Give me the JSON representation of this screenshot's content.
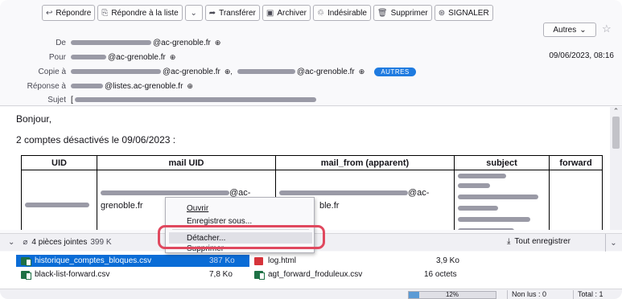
{
  "toolbar": {
    "reply": "Répondre",
    "reply_all": "Répondre à la liste",
    "forward": "Transférer",
    "archive": "Archiver",
    "junk": "Indésirable",
    "delete": "Supprimer",
    "report": "SIGNALER",
    "more": "Autres"
  },
  "header": {
    "from_label": "De",
    "from_value": "@ac-grenoble.fr",
    "to_label": "Pour",
    "to_value": "@ac-grenoble.fr",
    "cc_label": "Copie à",
    "cc_value_1": "@ac-grenoble.fr",
    "cc_value_2": "@ac-grenoble.fr",
    "cc_badge": "AUTRES",
    "replyto_label": "Réponse à",
    "replyto_value": "@listes.ac-grenoble.fr",
    "subject_label": "Sujet",
    "subject_value": "[",
    "date": "09/06/2023, 08:16"
  },
  "body": {
    "greeting": "Bonjour,",
    "summary": "2 comptes désactivés le 09/06/2023 :",
    "table": {
      "headers": [
        "UID",
        "mail UID",
        "mail_from (apparent)",
        "subject",
        "forward"
      ],
      "cell_mail_uid_1": "@ac-",
      "cell_mail_uid_2": "grenoble.fr",
      "cell_mail_from_1": "@ac-",
      "cell_mail_from_2": "ble.fr"
    }
  },
  "attachments": {
    "summary": "4 pièces jointes",
    "total_size_partial": "399 K",
    "save_all": "Tout enregistrer",
    "items": [
      {
        "name": "historique_comptes_bloques.csv",
        "size": "387 Ko"
      },
      {
        "name": "log.html",
        "size": "3,9 Ko"
      },
      {
        "name": "black-list-forward.csv",
        "size": "7,8 Ko"
      },
      {
        "name": "agt_forward_froduleux.csv",
        "size": "16 octets"
      }
    ]
  },
  "context_menu": {
    "open": "Ouvrir",
    "save_as": "Enregistrer sous...",
    "detach": "Détacher...",
    "delete": "Supprimer"
  },
  "status": {
    "progress_text": "12%",
    "progress_value": 0.12,
    "unread": "Non lus : 0",
    "total": "Total : 1"
  },
  "colors": {
    "accent": "#0a6cd6",
    "badge": "#1f7be0",
    "highlight_ring": "#e0485e"
  }
}
